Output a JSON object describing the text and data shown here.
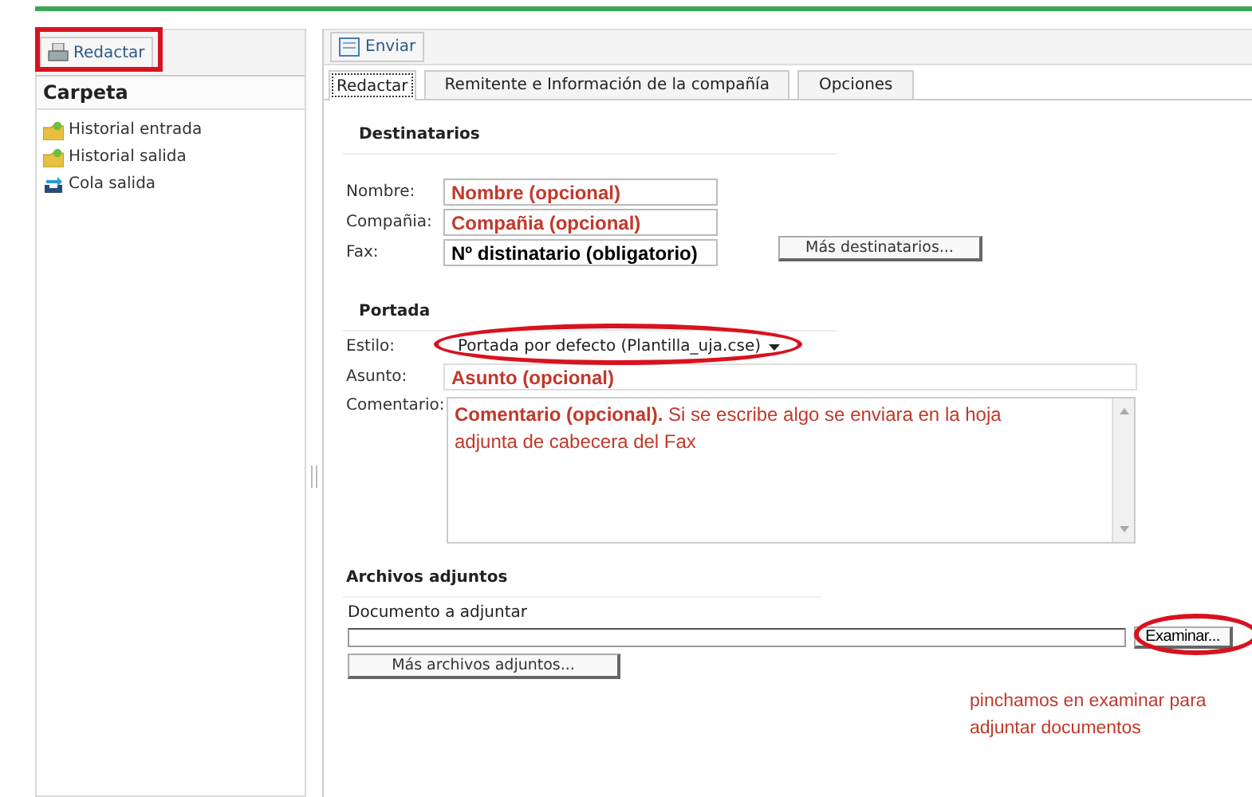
{
  "sidebar": {
    "compose_button": {
      "label": "Redactar",
      "highlighted": true
    },
    "heading": "Carpeta",
    "items": [
      {
        "label": "Historial entrada",
        "kind": "history"
      },
      {
        "label": "Historial salida",
        "kind": "history"
      },
      {
        "label": "Cola salida",
        "kind": "queue"
      }
    ]
  },
  "toolbar": {
    "send_button": "Enviar"
  },
  "tabs": [
    {
      "label": "Redactar",
      "selected": true
    },
    {
      "label": "Remitente e Información de la compañía",
      "selected": false
    },
    {
      "label": "Opciones",
      "selected": false
    }
  ],
  "recipients": {
    "heading": "Destinatarios",
    "fields": [
      {
        "label": "Nombre:",
        "value": "Nombre (opcional)",
        "color": "#c0392b"
      },
      {
        "label": "Compañia:",
        "value": "Compañia (opcional)",
        "color": "#c0392b"
      },
      {
        "label": "Fax:",
        "value": "Nº distinatario (obligatorio)",
        "color": "#000000"
      }
    ],
    "more_button": "Más destinatarios..."
  },
  "cover": {
    "heading": "Portada",
    "style": {
      "label": "Estilo:",
      "value": "Portada por defecto (Plantilla_uja.cse)",
      "highlighted": true
    },
    "subject": {
      "label": "Asunto:",
      "value": "Asunto (opcional)"
    },
    "comment": {
      "label": "Comentario:",
      "value": "**Comentario (opcional).** Si se escribe algo se enviara en la hoja adjunta de cabecera del Fax"
    }
  },
  "attachments": {
    "heading": "Archivos adjuntos",
    "label": "Documento a adjuntar",
    "browse_button": {
      "label": "Examinar...",
      "highlighted": true
    },
    "more_button": "Más archivos adjuntos..."
  },
  "note": "pinchamos en examinar para adjuntar documentos"
}
